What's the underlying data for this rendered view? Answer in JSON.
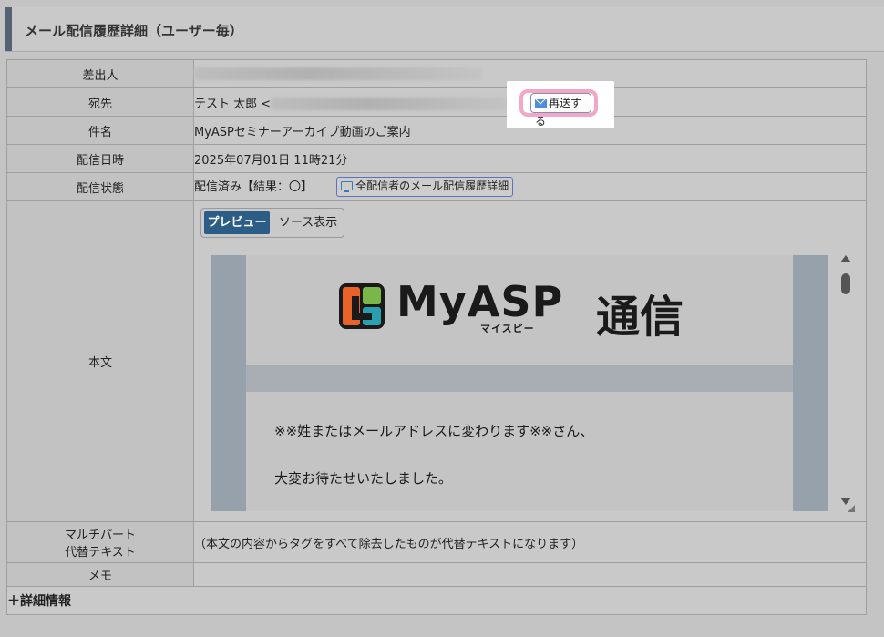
{
  "panel": {
    "title": "メール配信履歴詳細（ユーザー毎）"
  },
  "rows": {
    "sender": {
      "label": "差出人"
    },
    "recipient": {
      "label": "宛先",
      "value_prefix": "テスト 太郎  <",
      "value_suffix": ">",
      "resend_label": "再送する"
    },
    "subject": {
      "label": "件名",
      "value": "MyASPセミナーアーカイブ動画のご案内"
    },
    "datetime": {
      "label": "配信日時",
      "value": "2025年07月01日 11時21分"
    },
    "status": {
      "label": "配信状態",
      "value": "配信済み【結果：〇】",
      "all_history_label": "全配信者のメール配信履歴詳細"
    },
    "body": {
      "label": "本文"
    },
    "multipart": {
      "label_line1": "マルチパート",
      "label_line2": "代替テキスト",
      "value": "（本文の内容からタグをすべて除去したものが代替テキストになります）"
    },
    "memo": {
      "label": "メモ",
      "value": ""
    },
    "details": {
      "label": "＋詳細情報"
    }
  },
  "tabs": {
    "preview": "プレビュー",
    "source": "ソース表示"
  },
  "preview": {
    "logo_text": "MyASP",
    "logo_kana": "マイスピー",
    "logo_suffix": "通信",
    "line1": "※※姓またはメールアドレスに変わります※※さん、",
    "line2": "大変お待たせいたしました。"
  },
  "colors": {
    "accent": "#2b5d86",
    "highlight_ring": "#f4a6c6",
    "header_bar": "#566273",
    "logo_orange": "#e8622a",
    "logo_green": "#7ab648",
    "logo_teal": "#2a9fb0"
  },
  "icons": {
    "resend": "mail-icon",
    "all_history": "monitor-icon",
    "scroll_up": "arrow-up-icon",
    "scroll_down": "arrow-down-icon"
  }
}
